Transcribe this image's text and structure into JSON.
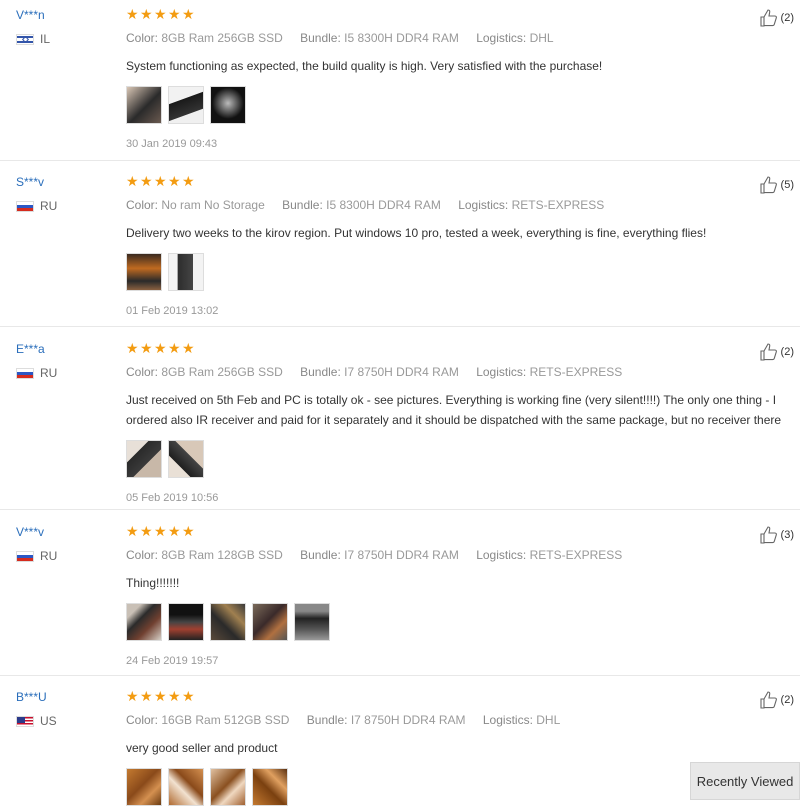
{
  "reviews": [
    {
      "user": "V***n",
      "country": "IL",
      "flag": "il",
      "stars": 5,
      "color_label": "Color:",
      "color_value": "8GB Ram 256GB SSD",
      "bundle_label": "Bundle:",
      "bundle_value": "I5 8300H DDR4 RAM",
      "logistics_label": "Logistics:",
      "logistics_value": "DHL",
      "text": "System functioning as expected, the build quality is high. Very satisfied with the purchase!",
      "photos": 3,
      "date": "30 Jan 2019 09:43",
      "likes": "(2)"
    },
    {
      "user": "S***v",
      "country": "RU",
      "flag": "ru",
      "stars": 5,
      "color_label": "Color:",
      "color_value": "No ram No Storage",
      "bundle_label": "Bundle:",
      "bundle_value": "I5 8300H DDR4 RAM",
      "logistics_label": "Logistics:",
      "logistics_value": "RETS-EXPRESS",
      "text": "Delivery two weeks to the kirov region. Put windows 10 pro, tested a week, everything is fine, everything flies!",
      "photos": 2,
      "date": "01 Feb 2019 13:02",
      "likes": "(5)"
    },
    {
      "user": "E***a",
      "country": "RU",
      "flag": "ru",
      "stars": 5,
      "color_label": "Color:",
      "color_value": "8GB Ram 256GB SSD",
      "bundle_label": "Bundle:",
      "bundle_value": "I7 8750H DDR4 RAM",
      "logistics_label": "Logistics:",
      "logistics_value": "RETS-EXPRESS",
      "text": "Just received on 5th Feb and PC is totally ok - see pictures. Everything is working fine (very silent!!!!) The only one thing - I ordered also IR receiver and paid for it separately and it should be dispatched with the same package, but no receiver there",
      "photos": 2,
      "date": "05 Feb 2019 10:56",
      "likes": "(2)"
    },
    {
      "user": "V***v",
      "country": "RU",
      "flag": "ru",
      "stars": 5,
      "color_label": "Color:",
      "color_value": "8GB Ram 128GB SSD",
      "bundle_label": "Bundle:",
      "bundle_value": "I7 8750H DDR4 RAM",
      "logistics_label": "Logistics:",
      "logistics_value": "RETS-EXPRESS",
      "text": "Thing!!!!!!!",
      "photos": 5,
      "date": "24 Feb 2019 19:57",
      "likes": "(3)"
    },
    {
      "user": "B***U",
      "country": "US",
      "flag": "us",
      "stars": 5,
      "color_label": "Color:",
      "color_value": "16GB Ram 512GB SSD",
      "bundle_label": "Bundle:",
      "bundle_value": "I7 8750H DDR4 RAM",
      "logistics_label": "Logistics:",
      "logistics_value": "DHL",
      "text": "very good seller and product",
      "photos": 4,
      "date": "",
      "likes": "(2)"
    }
  ],
  "recently_viewed": "Recently Viewed",
  "colors": {
    "accent": "#2a6ebb",
    "star": "#f39c12"
  }
}
